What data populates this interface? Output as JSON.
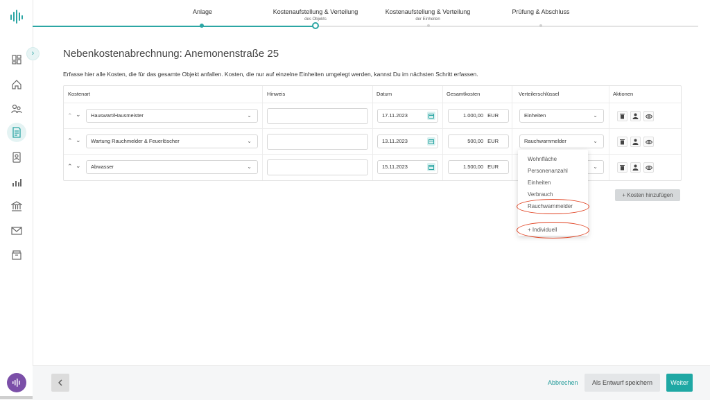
{
  "stepper": {
    "steps": [
      {
        "label": "Anlage",
        "sub": ""
      },
      {
        "label": "Kostenaufstellung & Verteilung",
        "sub": "des Objekts"
      },
      {
        "label": "Kostenaufstellung & Verteilung",
        "sub": "der Einheiten"
      },
      {
        "label": "Prüfung & Abschluss",
        "sub": ""
      }
    ],
    "active_index": 1,
    "accent_color": "#2ca6a4"
  },
  "sidebar": {
    "icons": [
      "dashboard-icon",
      "home-icon",
      "users-icon",
      "receipt-icon",
      "contacts-icon",
      "chart-icon",
      "bank-icon",
      "mail-icon",
      "archive-icon"
    ],
    "active_icon": "receipt-icon",
    "avatar_color": "#7b4fa8"
  },
  "page": {
    "title": "Nebenkostenabrechnung: Anemonenstraße 25",
    "intro": "Erfasse hier alle Kosten, die für das gesamte Objekt anfallen. Kosten, die nur auf einzelne Einheiten umgelegt werden, kannst Du im nächsten Schritt erfassen."
  },
  "table": {
    "headers": [
      "Kostenart",
      "Hinweis",
      "Datum",
      "Gesamtkosten",
      "Verteilerschlüssel",
      "Aktionen"
    ],
    "rows": [
      {
        "kostenart": "Hauswart/Hausmeister",
        "hinweis": "",
        "datum": "17.11.2023",
        "betrag": "1.000,00",
        "waehrung": "EUR",
        "schluessel": "Einheiten"
      },
      {
        "kostenart": "Wartung Rauchmelder & Feuerlöscher",
        "hinweis": "",
        "datum": "13.11.2023",
        "betrag": "500,00",
        "waehrung": "EUR",
        "schluessel": "Rauchwarnmelder"
      },
      {
        "kostenart": "Abwasser",
        "hinweis": "",
        "datum": "15.11.2023",
        "betrag": "1.500,00",
        "waehrung": "EUR",
        "schluessel": ""
      }
    ]
  },
  "dropdown": {
    "options": [
      "Wohnfläche",
      "Personenanzahl",
      "Einheiten",
      "Verbrauch",
      "Rauchwarnmelder",
      "+ Individuell"
    ],
    "highlight_color": "#e0401f"
  },
  "buttons": {
    "add_cost": "+ Kosten hinzufügen",
    "cancel": "Abbrechen",
    "save_draft": "Als Entwurf speichern",
    "next": "Weiter"
  }
}
